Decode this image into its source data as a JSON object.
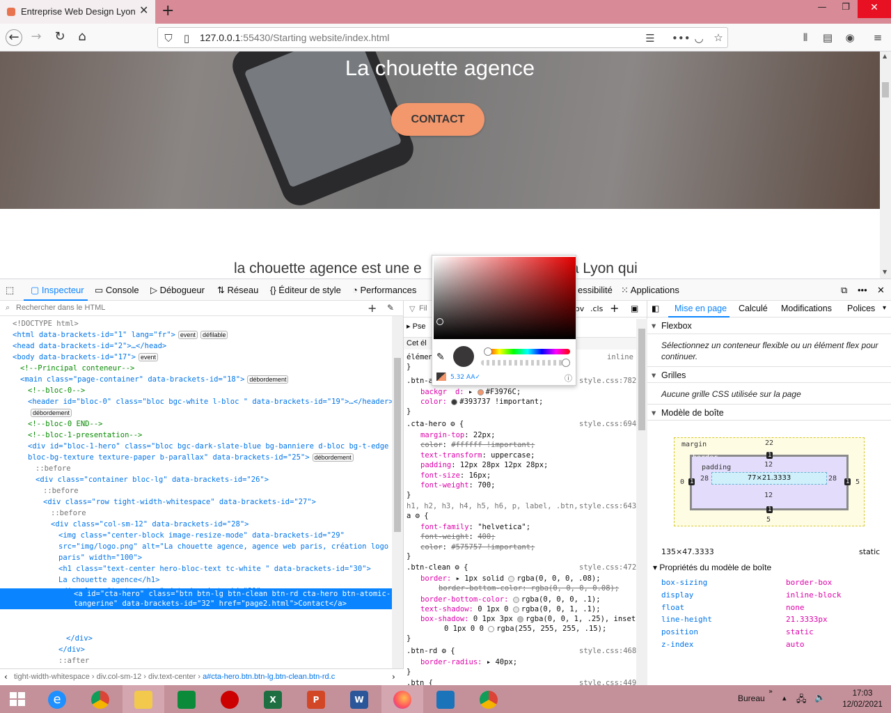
{
  "browser": {
    "tab_title": "Entreprise Web Design Lyon La chouette agence",
    "tab_close": "✕",
    "new_tab": "+",
    "url_host": "127.0.0.1",
    "url_rest": ":55430/Starting website/index.html"
  },
  "page": {
    "hero_title": "La chouette agence",
    "cta_label": "Contact",
    "presentation_text": "la chouette agence est une e",
    "presentation_tail": "à Lyon qui",
    "colors": {
      "cta_bg": "#F3976C",
      "cta_text": "#393737"
    }
  },
  "devtools": {
    "tabs": [
      "Inspecteur",
      "Console",
      "Débogueur",
      "Réseau",
      "Éditeur de style",
      "Performances",
      "essibilité",
      "Applications"
    ],
    "markup_search_placeholder": "Rechercher dans le HTML",
    "markup_lines": [
      {
        "t": "<!DOCTYPE html>",
        "indent": 0,
        "cls": "ps"
      },
      {
        "t": "<html data-brackets-id=\"1\" lang=\"fr\">",
        "indent": 0,
        "badges": [
          "event",
          "défilable"
        ]
      },
      {
        "t": "<head data-brackets-id=\"2\">…</head>",
        "indent": 0
      },
      {
        "t": "<body data-brackets-id=\"17\">",
        "indent": 0,
        "badges": [
          "event"
        ]
      },
      {
        "t": "<!--Principal conteneur-->",
        "indent": 1,
        "cls": "cm"
      },
      {
        "t": "<main class=\"page-container\" data-brackets-id=\"18\">",
        "indent": 1,
        "badges": [
          "débordement"
        ]
      },
      {
        "t": "<!--bloc-0-->",
        "indent": 2,
        "cls": "cm"
      },
      {
        "t": "<header id=\"bloc-0\" class=\"bloc bgc-white l-bloc \" data-brackets-id=\"19\">…</header>",
        "indent": 2
      },
      {
        "t": "",
        "indent": 2,
        "badges": [
          "débordement"
        ]
      },
      {
        "t": "<!--bloc-0 END-->",
        "indent": 2,
        "cls": "cm"
      },
      {
        "t": "<!--bloc-1-presentation-->",
        "indent": 2,
        "cls": "cm"
      },
      {
        "t": "<div id=\"bloc-1-hero\" class=\"bloc bgc-dark-slate-blue bg-banniere d-bloc bg-t-edge",
        "indent": 2
      },
      {
        "t": "bloc-bg-texture texture-paper b-parallax\" data-brackets-id=\"25\">",
        "indent": 2,
        "badges": [
          "débordement"
        ]
      },
      {
        "t": "::before",
        "indent": 3,
        "cls": "ps"
      },
      {
        "t": "<div class=\"container bloc-lg\" data-brackets-id=\"26\">",
        "indent": 3
      },
      {
        "t": "::before",
        "indent": 4,
        "cls": "ps"
      },
      {
        "t": "<div class=\"row tight-width-whitespace\" data-brackets-id=\"27\">",
        "indent": 4
      },
      {
        "t": "::before",
        "indent": 5,
        "cls": "ps"
      },
      {
        "t": "<div class=\"col-sm-12\" data-brackets-id=\"28\">",
        "indent": 5
      },
      {
        "t": "<img class=\"center-block image-resize-mode\" data-brackets-id=\"29\"",
        "indent": 6
      },
      {
        "t": "src=\"img/logo.png\" alt=\"La chouette agence, agence web paris, création logo",
        "indent": 6
      },
      {
        "t": "paris\" width=\"100\">",
        "indent": 6
      },
      {
        "t": "<h1 class=\"text-center hero-bloc-text tc-white \" data-brackets-id=\"30\">",
        "indent": 6
      },
      {
        "t": "La chouette agence</h1>",
        "indent": 6
      },
      {
        "t": "<div class=\"text-center\" data-brackets-id=\"31\">",
        "indent": 6
      },
      {
        "t": "",
        "indent": 7
      },
      {
        "t": "",
        "indent": 7
      },
      {
        "t": "</div>",
        "indent": 7
      },
      {
        "t": "</div>",
        "indent": 6
      },
      {
        "t": "::after",
        "indent": 6,
        "cls": "ps"
      },
      {
        "t": "</div>",
        "indent": 5
      },
      {
        "t": "::after",
        "indent": 5,
        "cls": "ps"
      }
    ],
    "selected_line1": "<a id=\"cta-hero\" class=\"btn btn-lg btn-clean btn-rd cta-hero btn-atomic-",
    "selected_line2": "tangerine\" data-brackets-id=\"32\" href=\"page2.html\">Contact</a>",
    "breadcrumb": [
      "tight-width-whitespace",
      "div.col-sm-12",
      "div.text-center",
      "a#cta-hero.btn.btn-lg.btn-clean.btn-rd.c"
    ],
    "rules_filter": "Fil",
    "rules_toggles": [
      "ov",
      ".cls"
    ],
    "rules": {
      "pseudo": "Pse",
      "this_element_header": "Cet él",
      "element_row": "élémen",
      "element_row_right": "inline",
      "r1_selector": ".btn-a",
      "r1_src": "style.css:782",
      "r1_bg_name": "backgr",
      "r1_bg_tail": "d:",
      "r1_bg_value": "#F3976C;",
      "r1_color_value": "#393737 !important;",
      "r2_selector": ".cta-hero",
      "r2_src": "style.css:694",
      "r2_props": [
        [
          "margin-top",
          "22px;",
          false
        ],
        [
          "color",
          "#ffffff !important;",
          true
        ],
        [
          "text-transform",
          "uppercase;",
          false
        ],
        [
          "padding",
          "12px 28px 12px 28px;",
          false
        ],
        [
          "font-size",
          "16px;",
          false
        ],
        [
          "font-weight",
          "700;",
          false
        ]
      ],
      "r3_selector": "h1, h2, h3, h4, h5, h6, p, label, .btn,",
      "r3_selector2": "a",
      "r3_src": "style.css:643",
      "r3_props": [
        [
          "font-family",
          "\"helvetica\";",
          false
        ],
        [
          "font-weight",
          "400;",
          true
        ],
        [
          "color",
          "#575757 !important;",
          true
        ]
      ],
      "r4_selector": ".btn-clean",
      "r4_src": "style.css:472",
      "r4_border": "1px solid",
      "r4_border_rgba": "rgba(0, 0, 0, .08);",
      "r4_bbc_sub": "border-bottom-color: rgba(0, 0, 0, 0.08);",
      "r4_bbc": "rgba(0, 0, 0, .1);",
      "r4_ts": "0 1px 0",
      "r4_ts_rgba": "rgba(0, 0, 1, .1);",
      "r4_bs": "0 1px 3px",
      "r4_bs_rgba": "rgba(0, 0, 1, .25), inset",
      "r4_bs2": "0 1px 0 0",
      "r4_bs2_rgba": "rgba(255, 255, 255, .15);",
      "r5_selector": ".btn-rd",
      "r5_src": "style.css:468",
      "r5_br": "40px;",
      "r6_selector": ".btn {",
      "r6_src": "style.css:449"
    },
    "picker": {
      "contrast": "5.32",
      "grade": "AA"
    },
    "layout_tabs": [
      "Mise en page",
      "Calculé",
      "Modifications",
      "Polices"
    ],
    "flexbox_title": "Flexbox",
    "flexbox_text": "Sélectionnez un conteneur flexible ou un élément flex pour continuer.",
    "grids_title": "Grilles",
    "grids_text": "Aucune grille CSS utilisée sur la page",
    "boxmodel_title": "Modèle de boîte",
    "bm": {
      "margin_label": "margin",
      "border_label": "border",
      "padding_label": "padding",
      "margin_top": "22",
      "margin_left": "0",
      "margin_right": "5",
      "margin_bottom": "5",
      "border_top": "1",
      "border_left": "1",
      "border_right": "1",
      "border_bottom": "1",
      "padding_top": "12",
      "padding_left": "28",
      "padding_right": "28",
      "padding_bottom": "12",
      "content": "77×21.3333"
    },
    "dimensions": "135×47.3333",
    "position_static": "static",
    "props_title": "Propriétés du modèle de boîte",
    "props": [
      [
        "box-sizing",
        "border-box"
      ],
      [
        "display",
        "inline-block"
      ],
      [
        "float",
        "none"
      ],
      [
        "line-height",
        "21.3333px"
      ],
      [
        "position",
        "static"
      ],
      [
        "z-index",
        "auto"
      ]
    ]
  },
  "taskbar": {
    "bureau": "Bureau",
    "time": "17:03",
    "date": "12/02/2021"
  }
}
